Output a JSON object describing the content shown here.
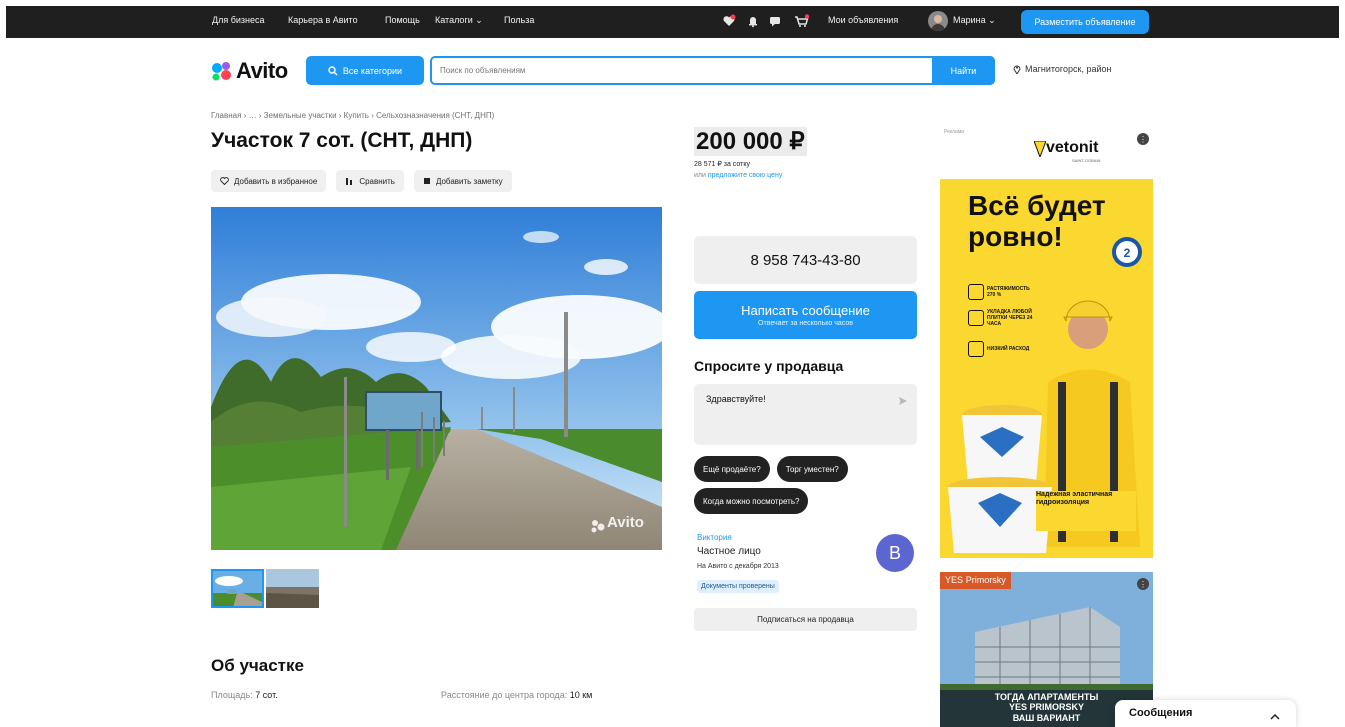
{
  "topbar": {
    "links": [
      "Для бизнеса",
      "Карьера в Авито",
      "Помощь",
      "Каталоги",
      "Польза"
    ],
    "my_ads": "Мои объявления",
    "user_name": "Марина",
    "post_ad": "Разместить объявление",
    "icons": [
      "heart-icon",
      "bell-icon",
      "chat-icon",
      "cart-icon"
    ]
  },
  "header": {
    "logo": "Avito",
    "all_categories": "Все категории",
    "search_placeholder": "Поиск по объявлениям",
    "find": "Найти",
    "location": "Магнитогорск, район"
  },
  "breadcrumbs": [
    "Главная",
    "…",
    "Земельные участки",
    "Купить",
    "Сельхозназначения (СНТ, ДНП)"
  ],
  "listing": {
    "title": "Участок 7 сот. (СНТ, ДНП)",
    "actions": [
      "Добавить в избранное",
      "Сравнить",
      "Добавить заметку"
    ],
    "photo_watermark": "Avito",
    "about_title": "Об участке",
    "params": [
      {
        "label": "Площадь:",
        "value": "7 сот."
      },
      {
        "label": "Расстояние до центра города:",
        "value": "10 км"
      }
    ]
  },
  "sidebar": {
    "price": "200 000 ₽",
    "price_per": "28 571 ₽ за сотку",
    "offer_prefix": "или",
    "offer_link": "предложите свою цену",
    "phone": "8 958 743-43-80",
    "message_button": "Написать сообщение",
    "message_sub": "Отвечает за несколько часов",
    "ask_title": "Спросите у продавца",
    "ask_text": "Здравствуйте!",
    "chips": [
      "Ещё продаёте?",
      "Торг уместен?",
      "Когда можно посмотреть?"
    ],
    "seller_name": "Виктория",
    "seller_type": "Частное лицо",
    "seller_since": "На Авито с декабря 2013",
    "seller_docs": "Документы проверены",
    "avatar_letter": "В",
    "subscribe": "Подписаться на продавца"
  },
  "ads": {
    "ad1": {
      "label": "Реклама",
      "brand": "vetonit",
      "brand_sub": "SAINT-GOBAIN",
      "headline_1": "Всё будет",
      "headline_2": "ровно!",
      "features": [
        "РАСТЯЖИМОСТЬ 270 %",
        "УКЛАДКА ЛЮБОЙ ПЛИТКИ ЧЕРЕЗ 24 ЧАСА",
        "НИЗКИЙ РАСХОД"
      ],
      "tagline": "Надежная эластичная гидроизоляция"
    },
    "ad2": {
      "logo": "YES",
      "logo_sub": "Primorsky",
      "caption_1": "ТОГДА АПАРТАМЕНТЫ",
      "caption_2": "YES PRIMORSKY",
      "caption_3": "ВАШ ВАРИАНТ"
    }
  },
  "messenger": {
    "label": "Сообщения"
  },
  "colors": {
    "accent": "#1e97f3",
    "topbar": "#1f1f1f",
    "chip": "#222222"
  }
}
